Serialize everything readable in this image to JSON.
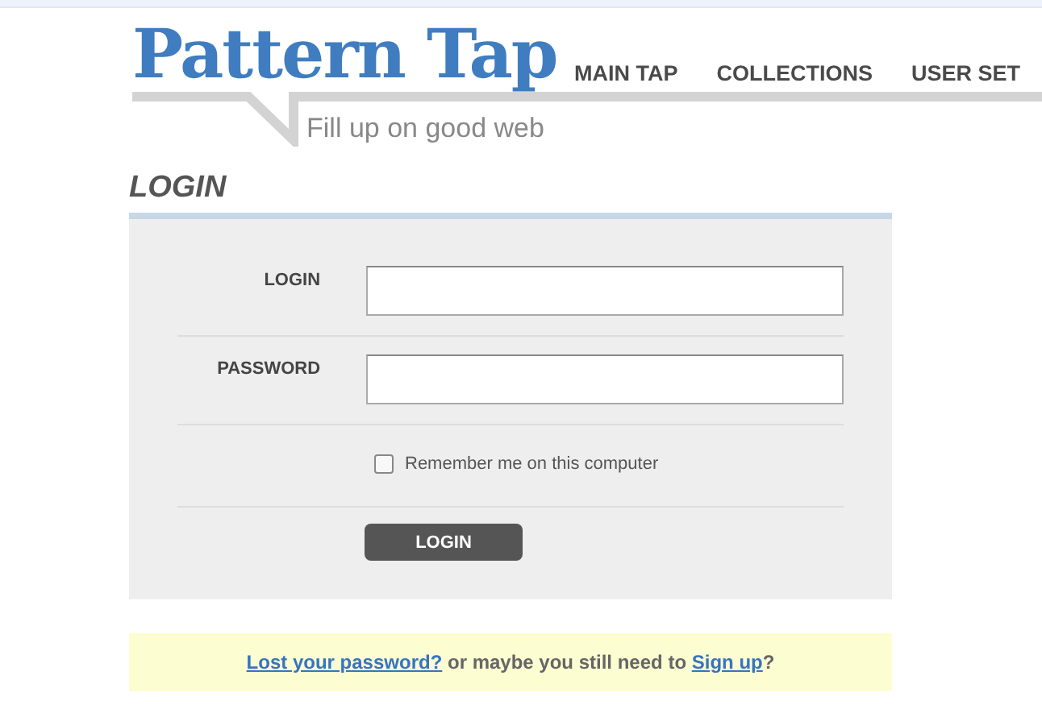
{
  "logo": {
    "title": "Pattern Tap",
    "tagline": "Fill up on good web"
  },
  "nav": [
    {
      "label": "MAIN TAP"
    },
    {
      "label": "COLLECTIONS"
    },
    {
      "label": "USER SET"
    }
  ],
  "heading": "LOGIN",
  "fields": [
    {
      "label": "LOGIN"
    },
    {
      "label": "PASSWORD"
    }
  ],
  "remember": {
    "label": "Remember me on this computer",
    "checked": false
  },
  "submit": "LOGIN",
  "help": [
    {
      "kind": "link",
      "text": "Lost your password?"
    },
    {
      "kind": "text",
      "text": " or maybe you still need to "
    },
    {
      "kind": "link",
      "text": "Sign up"
    },
    {
      "kind": "text",
      "text": "?"
    }
  ]
}
